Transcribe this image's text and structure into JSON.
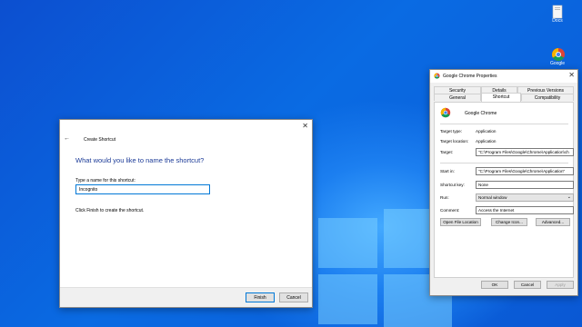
{
  "desktop": {
    "icons": [
      {
        "name": "docs-folder-icon",
        "label": "Docs"
      },
      {
        "name": "chrome-shortcut-icon",
        "label": "Google"
      }
    ]
  },
  "wizard": {
    "title": "Create Shortcut",
    "heading": "What would you like to name the shortcut?",
    "name_label": "Type a name for this shortcut:",
    "name_value": "Incognito",
    "hint": "Click Finish to create the shortcut.",
    "finish_label": "Finish",
    "cancel_label": "Cancel"
  },
  "props": {
    "title": "Google Chrome Properties",
    "tabs_row1": [
      "Security",
      "Details",
      "Previous Versions"
    ],
    "tabs_row2": [
      "General",
      "Shortcut",
      "Compatibility"
    ],
    "active_tab": "Shortcut",
    "app_name": "Google Chrome",
    "target_type_label": "Target type:",
    "target_type_value": "Application",
    "target_location_label": "Target location:",
    "target_location_value": "Application",
    "target_label": "Target:",
    "target_value": "\"C:\\Program Files\\Google\\Chrome\\Application\\ch",
    "start_in_label": "Start in:",
    "start_in_value": "\"C:\\Program Files\\Google\\Chrome\\Application\"",
    "shortcut_key_label": "Shortcut key:",
    "shortcut_key_value": "None",
    "run_label": "Run:",
    "run_value": "Normal window",
    "comment_label": "Comment:",
    "comment_value": "Access the Internet",
    "open_file_location_label": "Open File Location",
    "change_icon_label": "Change Icon...",
    "advanced_label": "Advanced...",
    "ok_label": "OK",
    "cancel_label": "Cancel",
    "apply_label": "Apply"
  }
}
